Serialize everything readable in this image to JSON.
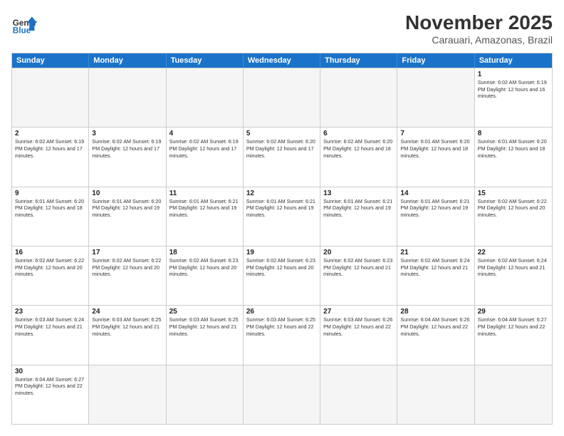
{
  "header": {
    "logo_general": "General",
    "logo_blue": "Blue",
    "month_title": "November 2025",
    "subtitle": "Carauari, Amazonas, Brazil"
  },
  "days_of_week": [
    "Sunday",
    "Monday",
    "Tuesday",
    "Wednesday",
    "Thursday",
    "Friday",
    "Saturday"
  ],
  "weeks": [
    {
      "cells": [
        {
          "day": "",
          "info": "",
          "empty": true
        },
        {
          "day": "",
          "info": "",
          "empty": true
        },
        {
          "day": "",
          "info": "",
          "empty": true
        },
        {
          "day": "",
          "info": "",
          "empty": true
        },
        {
          "day": "",
          "info": "",
          "empty": true
        },
        {
          "day": "",
          "info": "",
          "empty": true
        },
        {
          "day": "1",
          "info": "Sunrise: 6:02 AM\nSunset: 6:19 PM\nDaylight: 12 hours\nand 16 minutes.",
          "empty": false
        }
      ]
    },
    {
      "cells": [
        {
          "day": "2",
          "info": "Sunrise: 6:02 AM\nSunset: 6:19 PM\nDaylight: 12 hours\nand 17 minutes.",
          "empty": false
        },
        {
          "day": "3",
          "info": "Sunrise: 6:02 AM\nSunset: 6:19 PM\nDaylight: 12 hours\nand 17 minutes.",
          "empty": false
        },
        {
          "day": "4",
          "info": "Sunrise: 6:02 AM\nSunset: 6:19 PM\nDaylight: 12 hours\nand 17 minutes.",
          "empty": false
        },
        {
          "day": "5",
          "info": "Sunrise: 6:02 AM\nSunset: 6:20 PM\nDaylight: 12 hours\nand 17 minutes.",
          "empty": false
        },
        {
          "day": "6",
          "info": "Sunrise: 6:02 AM\nSunset: 6:20 PM\nDaylight: 12 hours\nand 18 minutes.",
          "empty": false
        },
        {
          "day": "7",
          "info": "Sunrise: 6:01 AM\nSunset: 6:20 PM\nDaylight: 12 hours\nand 18 minutes.",
          "empty": false
        },
        {
          "day": "8",
          "info": "Sunrise: 6:01 AM\nSunset: 6:20 PM\nDaylight: 12 hours\nand 18 minutes.",
          "empty": false
        }
      ]
    },
    {
      "cells": [
        {
          "day": "9",
          "info": "Sunrise: 6:01 AM\nSunset: 6:20 PM\nDaylight: 12 hours\nand 18 minutes.",
          "empty": false
        },
        {
          "day": "10",
          "info": "Sunrise: 6:01 AM\nSunset: 6:20 PM\nDaylight: 12 hours\nand 19 minutes.",
          "empty": false
        },
        {
          "day": "11",
          "info": "Sunrise: 6:01 AM\nSunset: 6:21 PM\nDaylight: 12 hours\nand 19 minutes.",
          "empty": false
        },
        {
          "day": "12",
          "info": "Sunrise: 6:01 AM\nSunset: 6:21 PM\nDaylight: 12 hours\nand 19 minutes.",
          "empty": false
        },
        {
          "day": "13",
          "info": "Sunrise: 6:01 AM\nSunset: 6:21 PM\nDaylight: 12 hours\nand 19 minutes.",
          "empty": false
        },
        {
          "day": "14",
          "info": "Sunrise: 6:01 AM\nSunset: 6:21 PM\nDaylight: 12 hours\nand 19 minutes.",
          "empty": false
        },
        {
          "day": "15",
          "info": "Sunrise: 6:02 AM\nSunset: 6:22 PM\nDaylight: 12 hours\nand 20 minutes.",
          "empty": false
        }
      ]
    },
    {
      "cells": [
        {
          "day": "16",
          "info": "Sunrise: 6:02 AM\nSunset: 6:22 PM\nDaylight: 12 hours\nand 20 minutes.",
          "empty": false
        },
        {
          "day": "17",
          "info": "Sunrise: 6:02 AM\nSunset: 6:22 PM\nDaylight: 12 hours\nand 20 minutes.",
          "empty": false
        },
        {
          "day": "18",
          "info": "Sunrise: 6:02 AM\nSunset: 6:23 PM\nDaylight: 12 hours\nand 20 minutes.",
          "empty": false
        },
        {
          "day": "19",
          "info": "Sunrise: 6:02 AM\nSunset: 6:23 PM\nDaylight: 12 hours\nand 20 minutes.",
          "empty": false
        },
        {
          "day": "20",
          "info": "Sunrise: 6:02 AM\nSunset: 6:23 PM\nDaylight: 12 hours\nand 21 minutes.",
          "empty": false
        },
        {
          "day": "21",
          "info": "Sunrise: 6:02 AM\nSunset: 6:24 PM\nDaylight: 12 hours\nand 21 minutes.",
          "empty": false
        },
        {
          "day": "22",
          "info": "Sunrise: 6:02 AM\nSunset: 6:24 PM\nDaylight: 12 hours\nand 21 minutes.",
          "empty": false
        }
      ]
    },
    {
      "cells": [
        {
          "day": "23",
          "info": "Sunrise: 6:03 AM\nSunset: 6:24 PM\nDaylight: 12 hours\nand 21 minutes.",
          "empty": false
        },
        {
          "day": "24",
          "info": "Sunrise: 6:03 AM\nSunset: 6:25 PM\nDaylight: 12 hours\nand 21 minutes.",
          "empty": false
        },
        {
          "day": "25",
          "info": "Sunrise: 6:03 AM\nSunset: 6:25 PM\nDaylight: 12 hours\nand 21 minutes.",
          "empty": false
        },
        {
          "day": "26",
          "info": "Sunrise: 6:03 AM\nSunset: 6:25 PM\nDaylight: 12 hours\nand 22 minutes.",
          "empty": false
        },
        {
          "day": "27",
          "info": "Sunrise: 6:03 AM\nSunset: 6:26 PM\nDaylight: 12 hours\nand 22 minutes.",
          "empty": false
        },
        {
          "day": "28",
          "info": "Sunrise: 6:04 AM\nSunset: 6:26 PM\nDaylight: 12 hours\nand 22 minutes.",
          "empty": false
        },
        {
          "day": "29",
          "info": "Sunrise: 6:04 AM\nSunset: 6:27 PM\nDaylight: 12 hours\nand 22 minutes.",
          "empty": false
        }
      ]
    },
    {
      "cells": [
        {
          "day": "30",
          "info": "Sunrise: 6:04 AM\nSunset: 6:27 PM\nDaylight: 12 hours\nand 22 minutes.",
          "empty": false
        },
        {
          "day": "",
          "info": "",
          "empty": true
        },
        {
          "day": "",
          "info": "",
          "empty": true
        },
        {
          "day": "",
          "info": "",
          "empty": true
        },
        {
          "day": "",
          "info": "",
          "empty": true
        },
        {
          "day": "",
          "info": "",
          "empty": true
        },
        {
          "day": "",
          "info": "",
          "empty": true
        }
      ]
    }
  ]
}
